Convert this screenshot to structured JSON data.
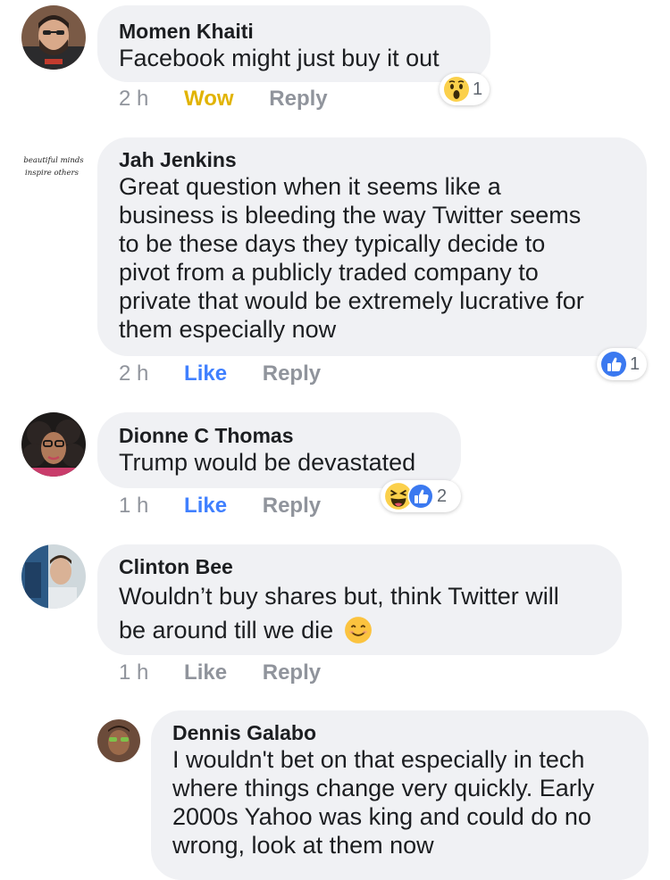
{
  "comments": [
    {
      "author": "Momen Khaiti",
      "text": "Facebook might just buy it out",
      "time": "2 h",
      "action": "Wow",
      "reply": "Reply",
      "reaction_count": "1",
      "reactions": [
        "wow-icon"
      ]
    },
    {
      "author": "Jah Jenkins",
      "text_lines": [
        "Great question when it seems like a",
        "business is bleeding the way Twitter seems",
        "to be these days they typically decide to",
        "pivot from a publicly traded company to",
        "private that would be extremely lucrative for",
        "them especially now"
      ],
      "avatar_text_lines": [
        "beautiful minds",
        "inspire others"
      ],
      "time": "2 h",
      "action": "Like",
      "reply": "Reply",
      "reaction_count": "1",
      "reactions": [
        "like-icon"
      ]
    },
    {
      "author": "Dionne C Thomas",
      "text": "Trump would be devastated",
      "time": "1 h",
      "action": "Like",
      "reply": "Reply",
      "reaction_count": "2",
      "reactions": [
        "haha-icon",
        "like-icon"
      ]
    },
    {
      "author": "Clinton Bee",
      "text_lines": [
        "Wouldn’t buy shares but, think Twitter will",
        "be around till we die"
      ],
      "emoji": "smile-emoji-icon",
      "time": "1 h",
      "action": "Like",
      "reply": "Reply"
    },
    {
      "author": "Dennis Galabo",
      "text_lines": [
        "I wouldn't bet on that especially in tech",
        "where things change very quickly. Early",
        "2000s Yahoo was king and could do no",
        "wrong, look at them now"
      ]
    }
  ],
  "colors": {
    "bubble": "#f0f1f4",
    "meta_gray": "#90949c",
    "like_blue": "#4080ff",
    "wow_yellow": "#e1b300"
  }
}
